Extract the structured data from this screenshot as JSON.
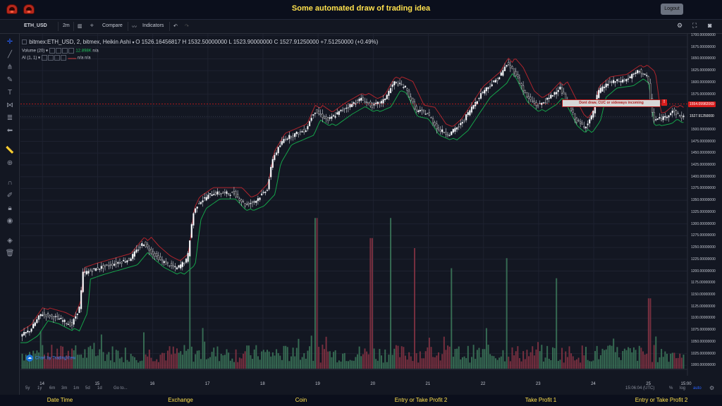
{
  "page": {
    "title": "Some automated draw of trading idea",
    "logout_label": "Logout"
  },
  "toolbar": {
    "symbol": "ETH_USD",
    "interval": "2m",
    "compare": "Compare",
    "indicators": "Indicators"
  },
  "legend": {
    "series": "bitmex:ETH_USD, 2, bitmex, Heikin Ashi",
    "open": "O 1526.16456817",
    "high": "H 1532.50000000",
    "low": "L 1523.90000000",
    "close": "C 1527.91250000",
    "change": "+7.51250000 (+0.49%)"
  },
  "indicators": {
    "volume_label": "Volume (20)",
    "volume_value": "12.898K",
    "volume_na": "n/a",
    "ai_label": "AI (1, 1)",
    "ai_value1": "n/a",
    "ai_value2": "n/a"
  },
  "annotation": {
    "text": "Dont draw, CUC or sideways incoming",
    "alert_mark": "!"
  },
  "watermark": "Chart by TradingView",
  "price_tags": {
    "alert": "1554.09982069",
    "last": "1527.91250000"
  },
  "bottombar": {
    "ranges": [
      "5y",
      "1y",
      "6m",
      "3m",
      "1m",
      "5d",
      "1d"
    ],
    "goto": "Go to...",
    "time": "15:06:04 (UTC)",
    "percent": "%",
    "log": "log",
    "auto": "auto"
  },
  "bottom_tabs": [
    "Date Time",
    "Exchange",
    "Coin",
    "Entry or Take Profit 2",
    "Take Profit 1",
    "Entry or Take Profit 2"
  ],
  "colors": {
    "title": "#ffe14d",
    "background": "#131722",
    "up_candle": "#ffffff",
    "down_candle": "#1a1a1a",
    "ma_green": "#15a34a",
    "ma_red": "#c0262d",
    "volume_up": "#3d7a5c",
    "volume_down": "#8a3444",
    "alert_line": "#d91c1c"
  },
  "chart_data": {
    "type": "candlestick",
    "symbol": "bitmex:ETH_USD",
    "chart_style": "Heikin Ashi",
    "y_ticks": [
      "1700.00000000",
      "1675.00000000",
      "1650.00000000",
      "1625.00000000",
      "1600.00000000",
      "1575.00000000",
      "1550.00000000",
      "1525.00000000",
      "1500.00000000",
      "1475.00000000",
      "1450.00000000",
      "1425.00000000",
      "1400.00000000",
      "1375.00000000",
      "1350.00000000",
      "1325.00000000",
      "1300.00000000",
      "1275.00000000",
      "1250.00000000",
      "1225.00000000",
      "1200.00000000",
      "1175.00000000",
      "1150.00000000",
      "1125.00000000",
      "1100.00000000",
      "1075.00000000",
      "1050.00000000",
      "1025.00000000",
      "1000.00000000"
    ],
    "ylim": [
      993,
      1703
    ],
    "x_labels": [
      "14",
      "15",
      "16",
      "17",
      "18",
      "19",
      "20",
      "21",
      "22",
      "23",
      "24",
      "25",
      "15:00"
    ],
    "xlim": [
      13.6,
      25.7
    ],
    "x_label_positions": [
      14,
      15,
      16,
      17,
      18,
      19,
      20,
      21,
      22,
      23,
      24,
      25,
      25.63
    ],
    "price_path": [
      [
        13.6,
        1060
      ],
      [
        13.8,
        1075
      ],
      [
        14.0,
        1110
      ],
      [
        14.3,
        1100
      ],
      [
        14.55,
        1085
      ],
      [
        14.7,
        1125
      ],
      [
        14.75,
        1195
      ],
      [
        15.0,
        1205
      ],
      [
        15.3,
        1215
      ],
      [
        15.6,
        1225
      ],
      [
        15.85,
        1260
      ],
      [
        16.0,
        1240
      ],
      [
        16.2,
        1220
      ],
      [
        16.45,
        1205
      ],
      [
        16.65,
        1225
      ],
      [
        16.75,
        1320
      ],
      [
        16.85,
        1345
      ],
      [
        17.1,
        1365
      ],
      [
        17.5,
        1365
      ],
      [
        17.7,
        1340
      ],
      [
        17.9,
        1350
      ],
      [
        18.1,
        1375
      ],
      [
        18.2,
        1440
      ],
      [
        18.4,
        1480
      ],
      [
        18.6,
        1490
      ],
      [
        18.8,
        1500
      ],
      [
        18.95,
        1540
      ],
      [
        19.2,
        1520
      ],
      [
        19.5,
        1545
      ],
      [
        19.8,
        1565
      ],
      [
        20.0,
        1550
      ],
      [
        20.2,
        1560
      ],
      [
        20.4,
        1600
      ],
      [
        20.6,
        1590
      ],
      [
        20.8,
        1540
      ],
      [
        21.0,
        1535
      ],
      [
        21.2,
        1500
      ],
      [
        21.4,
        1490
      ],
      [
        21.6,
        1510
      ],
      [
        21.8,
        1545
      ],
      [
        22.0,
        1580
      ],
      [
        22.3,
        1610
      ],
      [
        22.45,
        1640
      ],
      [
        22.6,
        1620
      ],
      [
        22.8,
        1570
      ],
      [
        23.0,
        1550
      ],
      [
        23.2,
        1565
      ],
      [
        23.4,
        1590
      ],
      [
        23.55,
        1555
      ],
      [
        23.7,
        1520
      ],
      [
        23.85,
        1505
      ],
      [
        24.0,
        1530
      ],
      [
        24.1,
        1580
      ],
      [
        24.3,
        1600
      ],
      [
        24.6,
        1605
      ],
      [
        24.85,
        1625
      ],
      [
        25.0,
        1610
      ],
      [
        25.1,
        1520
      ],
      [
        25.3,
        1525
      ],
      [
        25.45,
        1540
      ],
      [
        25.6,
        1527
      ]
    ],
    "volume": {
      "note": "volume bars at bottom, relative heights",
      "peaks": [
        [
          16.65,
          0.6
        ],
        [
          18.95,
          0.75
        ],
        [
          19.95,
          0.65
        ],
        [
          20.3,
          0.75
        ],
        [
          20.75,
          0.6
        ],
        [
          21.4,
          0.5
        ],
        [
          22.4,
          0.55
        ],
        [
          23.3,
          0.45
        ],
        [
          25.0,
          0.35
        ]
      ]
    },
    "alert_level": 1554.09982069,
    "last_price": 1527.9125
  }
}
